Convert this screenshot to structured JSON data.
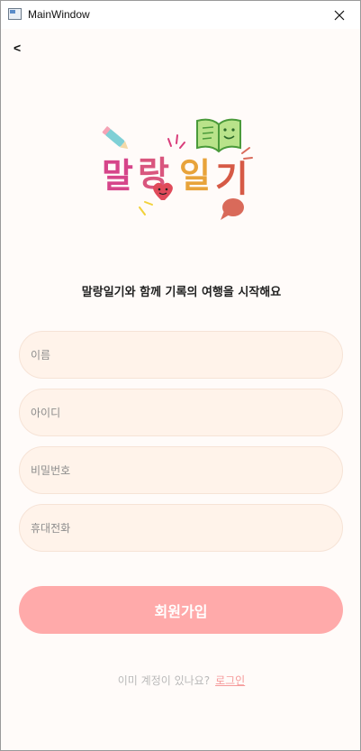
{
  "window": {
    "title": "MainWindow",
    "close_glyph": "✕"
  },
  "nav": {
    "back_label": "<"
  },
  "logo": {
    "text": "말랑일기"
  },
  "form": {
    "subtitle": "말랑일기와 함께 기록의 여행을 시작해요",
    "name_placeholder": "이름",
    "id_placeholder": "아이디",
    "password_placeholder": "비밀번호",
    "phone_placeholder": "휴대전화",
    "submit_label": "회원가입"
  },
  "footer": {
    "prompt": "이미 계정이 있나요?",
    "login_label": "로그인"
  },
  "colors": {
    "background": "#fffbf9",
    "field_bg": "#fff3ea",
    "button_bg": "#ffaaaa",
    "link": "#f59a9a"
  }
}
